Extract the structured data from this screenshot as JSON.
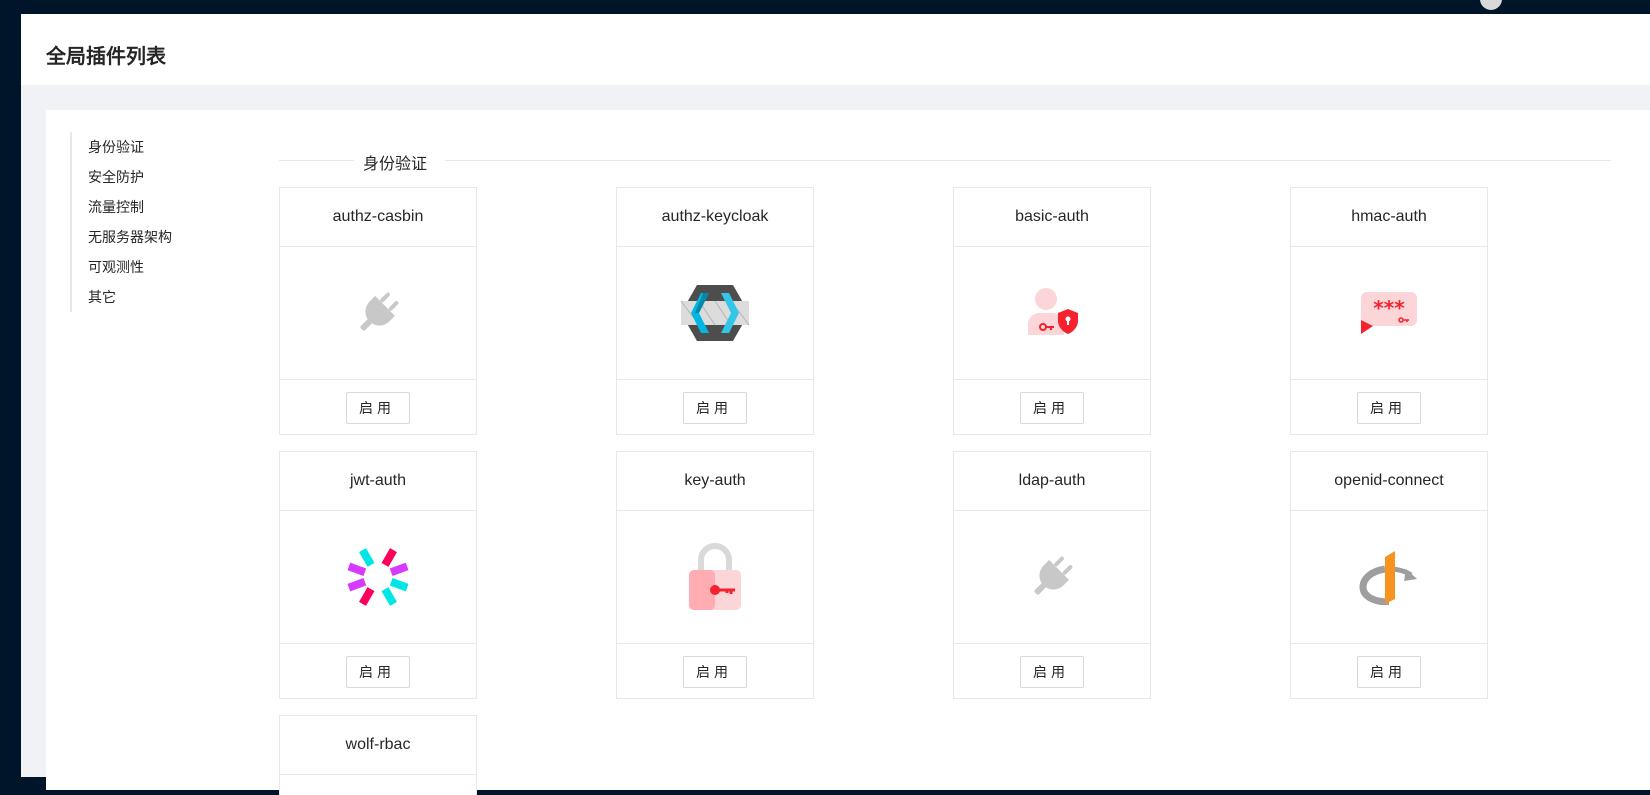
{
  "page": {
    "title": "全局插件列表"
  },
  "sidebar": {
    "items": [
      "身份验证",
      "安全防护",
      "流量控制",
      "无服务器架构",
      "可观测性",
      "其它"
    ]
  },
  "section": {
    "title": "身份验证"
  },
  "plugins": [
    {
      "name": "authz-casbin",
      "icon": "plug-icon",
      "button": "启用"
    },
    {
      "name": "authz-keycloak",
      "icon": "keycloak-icon",
      "button": "启用"
    },
    {
      "name": "basic-auth",
      "icon": "user-shield-icon",
      "button": "启用"
    },
    {
      "name": "hmac-auth",
      "icon": "password-bubble-icon",
      "button": "启用"
    },
    {
      "name": "jwt-auth",
      "icon": "jwt-icon",
      "button": "启用"
    },
    {
      "name": "key-auth",
      "icon": "padlock-key-icon",
      "button": "启用"
    },
    {
      "name": "ldap-auth",
      "icon": "plug-icon",
      "button": "启用"
    },
    {
      "name": "openid-connect",
      "icon": "openid-icon",
      "button": "启用"
    },
    {
      "name": "wolf-rbac",
      "icon": "",
      "button": ""
    }
  ],
  "colors": {
    "sider": "#001529",
    "background": "#f0f2f5",
    "accent_red": "#f5222d",
    "jwt_cyan": "#00e5e5",
    "jwt_magenta": "#d63aff",
    "jwt_pink": "#fb015b",
    "openid_orange": "#f7931e"
  }
}
